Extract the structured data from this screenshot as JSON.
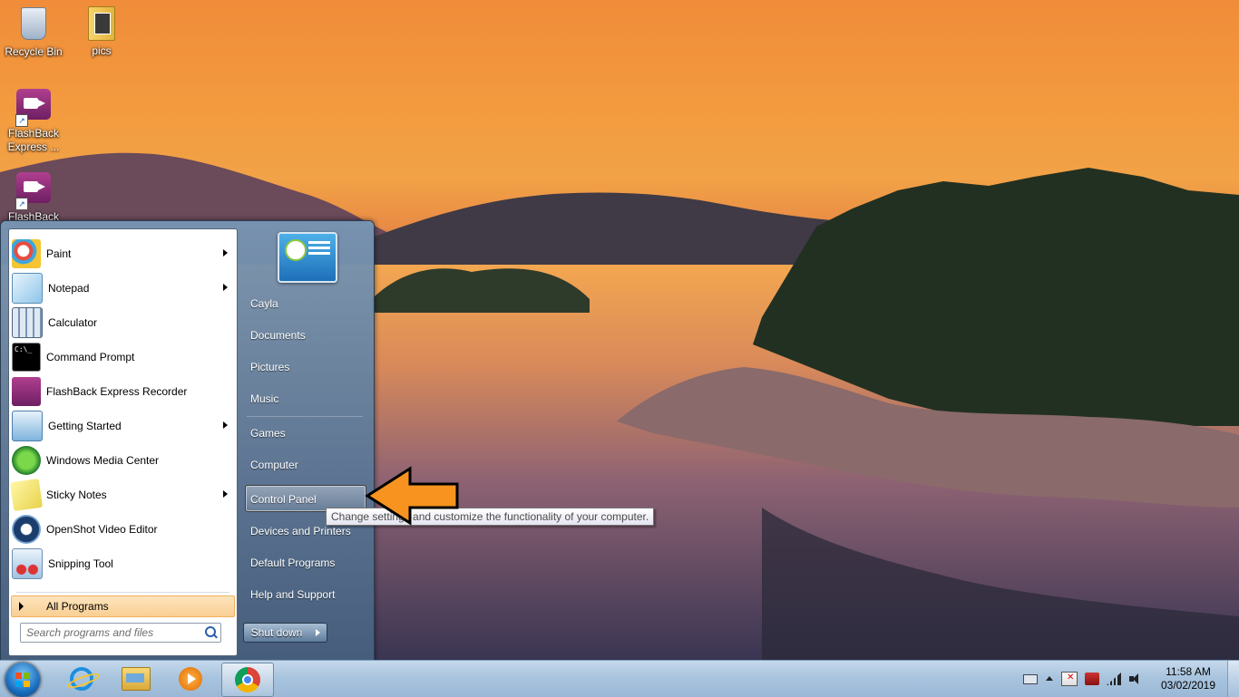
{
  "desktop": {
    "icons": [
      {
        "label": "Recycle Bin",
        "icon": "recycle-bin-icon"
      },
      {
        "label": "pics",
        "icon": "folder-icon"
      },
      {
        "label": "FlashBack Express ...",
        "icon": "flashback-player-icon"
      },
      {
        "label": "FlashBack",
        "icon": "flashback-recorder-icon"
      }
    ]
  },
  "start_menu": {
    "programs": [
      {
        "label": "Paint",
        "icon": "paint-icon",
        "has_submenu": true
      },
      {
        "label": "Notepad",
        "icon": "notepad-icon",
        "has_submenu": true
      },
      {
        "label": "Calculator",
        "icon": "calculator-icon",
        "has_submenu": false
      },
      {
        "label": "Command Prompt",
        "icon": "command-prompt-icon",
        "has_submenu": false
      },
      {
        "label": "FlashBack Express Recorder",
        "icon": "flashback-recorder-icon",
        "has_submenu": false
      },
      {
        "label": "Getting Started",
        "icon": "getting-started-icon",
        "has_submenu": true
      },
      {
        "label": "Windows Media Center",
        "icon": "media-center-icon",
        "has_submenu": false
      },
      {
        "label": "Sticky Notes",
        "icon": "sticky-notes-icon",
        "has_submenu": true
      },
      {
        "label": "OpenShot Video Editor",
        "icon": "openshot-icon",
        "has_submenu": false
      },
      {
        "label": "Snipping Tool",
        "icon": "snipping-tool-icon",
        "has_submenu": false
      }
    ],
    "all_programs_label": "All Programs",
    "search_placeholder": "Search programs and files",
    "right_items": [
      {
        "label": "Cayla"
      },
      {
        "label": "Documents"
      },
      {
        "label": "Pictures"
      },
      {
        "label": "Music"
      },
      {
        "label": "Games"
      },
      {
        "label": "Computer"
      },
      {
        "label": "Control Panel",
        "highlighted": true
      },
      {
        "label": "Devices and Printers"
      },
      {
        "label": "Default Programs"
      },
      {
        "label": "Help and Support"
      }
    ],
    "shutdown_label": "Shut down",
    "tooltip": "Change settings and customize the functionality of your computer."
  },
  "taskbar": {
    "pinned": [
      {
        "icon": "internet-explorer-icon"
      },
      {
        "icon": "windows-explorer-icon"
      },
      {
        "icon": "media-player-icon"
      },
      {
        "icon": "chrome-icon",
        "active": true
      }
    ],
    "clock": {
      "time": "11:58 AM",
      "date": "03/02/2019"
    }
  },
  "colors": {
    "accent": "#f7931e",
    "highlight": "#f9cf93"
  }
}
